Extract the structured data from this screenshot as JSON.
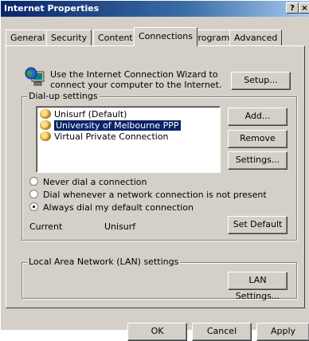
{
  "window": {
    "title": "Internet Properties",
    "help_btn": "?",
    "close_btn": "×"
  },
  "tabs": [
    {
      "label": "General"
    },
    {
      "label": "Security"
    },
    {
      "label": "Content"
    },
    {
      "label": "Connections"
    },
    {
      "label": "Programs"
    },
    {
      "label": "Advanced"
    }
  ],
  "active_tab": "Connections",
  "wizard": {
    "line1": "Use the Internet Connection Wizard to",
    "line2": "connect your computer to the Internet.",
    "setup_label": "Setup..."
  },
  "dialup": {
    "legend": "Dial-up settings",
    "items": [
      {
        "label": "Unisurf (Default)",
        "selected": false
      },
      {
        "label": "University of Melbourne PPP",
        "selected": true
      },
      {
        "label": "Virtual Private Connection",
        "selected": false
      }
    ],
    "add_label": "Add...",
    "remove_label": "Remove",
    "settings_label": "Settings...",
    "options": [
      {
        "label": "Never dial a connection",
        "checked": false
      },
      {
        "label": "Dial whenever a network connection is not present",
        "checked": false
      },
      {
        "label": "Always dial my default connection",
        "checked": true
      }
    ],
    "current_label": "Current",
    "current_value": "Unisurf",
    "set_default_label": "Set Default"
  },
  "lan": {
    "legend": "Local Area Network (LAN) settings",
    "lan_settings_label": "LAN Settings..."
  },
  "footer": {
    "ok": "OK",
    "cancel": "Cancel",
    "apply": "Apply"
  }
}
